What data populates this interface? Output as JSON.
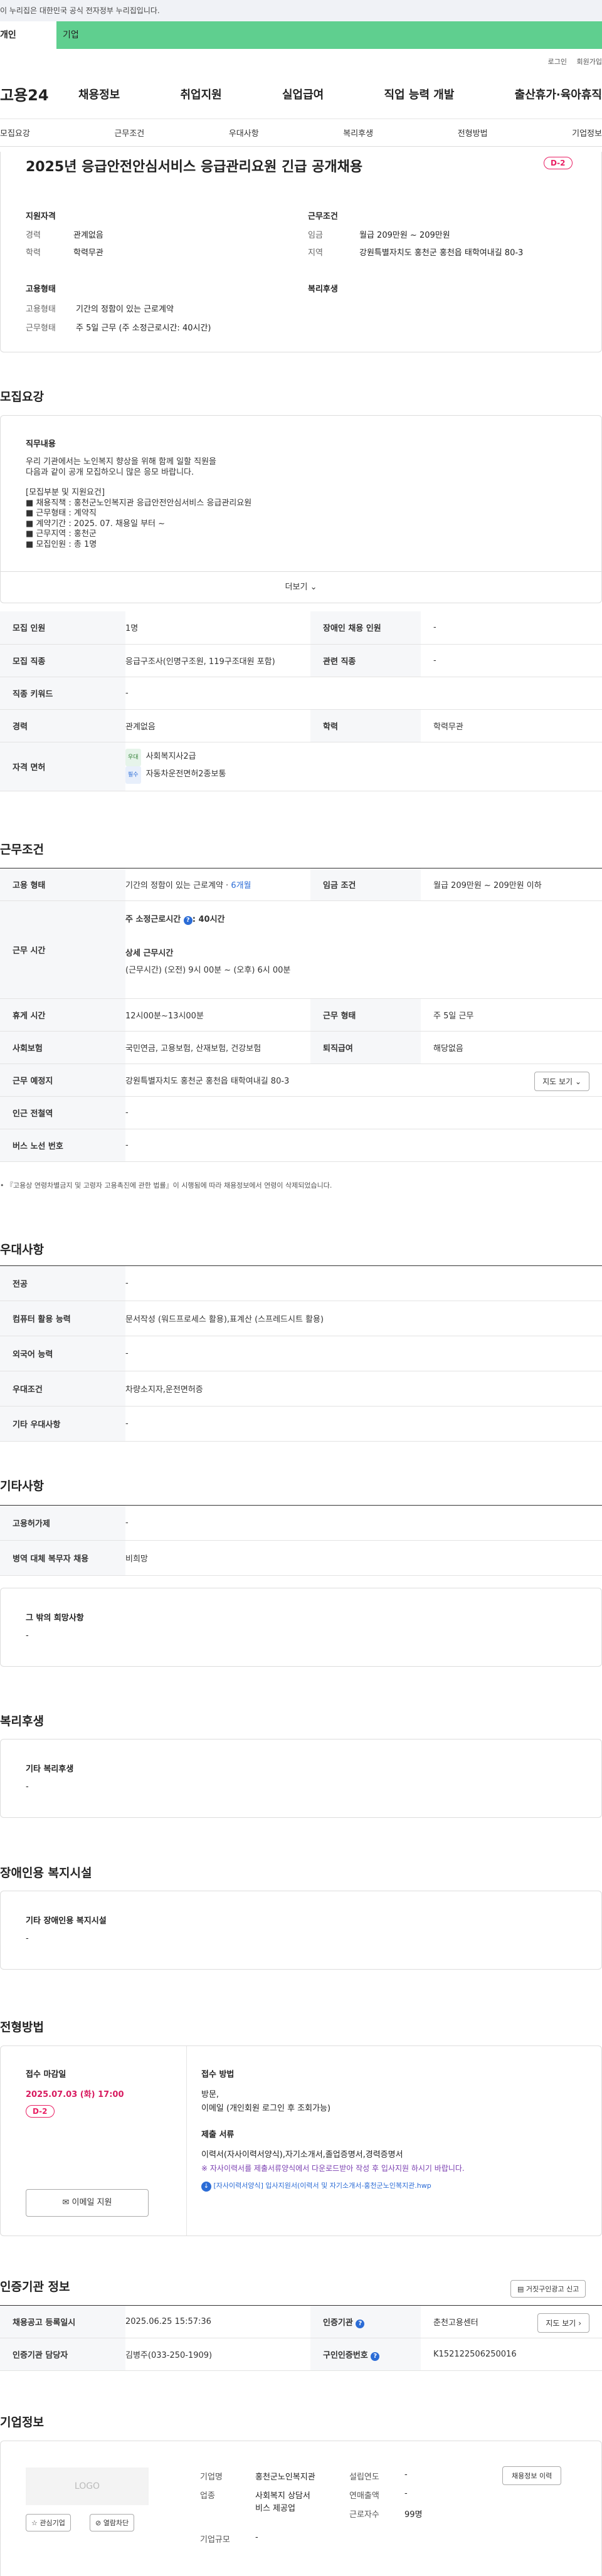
{
  "gov_banner": "이 누리집은 대한민국 공식 전자정부 누리집입니다.",
  "user_tabs": {
    "personal": "개인",
    "company": "기업"
  },
  "util": {
    "login": "로그인",
    "join": "회원가입"
  },
  "logo": "고용24",
  "gnb": [
    "채용정보",
    "취업지원",
    "실업급여",
    "직업 능력 개발",
    "출산휴가·육아휴직"
  ],
  "tabs": [
    "모집요강",
    "근무조건",
    "우대사항",
    "복리후생",
    "전형방법",
    "기업정보"
  ],
  "job": {
    "title": "2025년 응급안전안심서비스 응급관리요원 긴급 공개채용",
    "dday": "D-2",
    "qual_title": "지원자격",
    "career_k": "경력",
    "career_v": "관계없음",
    "edu_k": "학력",
    "edu_v": "학력무관",
    "cond_title": "근무조건",
    "wage_k": "임금",
    "wage_v": "월급 209만원 ~ 209만원",
    "region_k": "지역",
    "region_v": "강원특별자치도 홍천군 홍천읍 태학여내길 80-3",
    "emp_title": "고용형태",
    "emptype_k": "고용형태",
    "emptype_v": "기간의 정함이 있는 근로계약",
    "worktype_k": "근무형태",
    "worktype_v": "주 5일 근무 (주 소정근로시간: 40시간)",
    "welfare_title": "복리후생"
  },
  "recruit": {
    "section": "모집요강",
    "duty_title": "직무내용",
    "duty_lines": [
      "우리 기관에서는 노인복지 향상을 위해 함께 일할 직원을",
      "다음과 같이 공개 모집하오니 많은 응모 바랍니다.",
      "",
      "[모집부분 및 지원요건]",
      "■ 채용직책 : 홍천군노인복지관 응급안전안심서비스 응급관리요원",
      "■ 근무형태 : 계약직",
      "■ 계약기간 : 2025. 07. 채용일 부터 ~",
      "■ 근무지역 : 홍천군",
      "■ 모집인원 : 총 1명"
    ],
    "more": "더보기",
    "rows": {
      "count_k": "모집 인원",
      "count_v": "1명",
      "disabled_k": "장애인 채용 인원",
      "disabled_v": "-",
      "job_k": "모집 직종",
      "job_v": "응급구조사(인명구조원, 119구조대원 포함)",
      "related_k": "관련 직종",
      "related_v": "-",
      "keyword_k": "직종 키워드",
      "keyword_v": "-",
      "career_k": "경력",
      "career_v": "관계없음",
      "edu_k": "학력",
      "edu_v": "학력무관",
      "license_k": "자격 면허",
      "lic1_tag": "우대",
      "lic1": "사회복지사2급",
      "lic2_tag": "필수",
      "lic2": "자동차운전면허2종보통"
    }
  },
  "work": {
    "section": "근무조건",
    "emptype_k": "고용 형태",
    "emptype_v": "기간의 정함이 있는 근로계약 · ",
    "emptype_link": "6개월",
    "wage_k": "임금 조건",
    "wage_v": "월급 209만원 ~ 209만원 이하",
    "time_k": "근무 시간",
    "time_week": "주 소정근로시간",
    "time_week_v": ": 40시간",
    "time_detail_t": "상세 근무시간",
    "time_detail": "(근무시간) (오전) 9시 00분 ~ (오후) 6시 00분",
    "rest_k": "휴게 시간",
    "rest_v": "12시00분~13시00분",
    "form_k": "근무 형태",
    "form_v": "주 5일 근무",
    "ins_k": "사회보험",
    "ins_v": "국민연금, 고용보험, 산재보험, 건강보험",
    "retire_k": "퇴직급여",
    "retire_v": "해당없음",
    "place_k": "근무 예정지",
    "place_v": "강원특별자치도 홍천군 홍천읍 태학여내길 80-3",
    "map_btn": "지도 보기",
    "subway_k": "인근 전철역",
    "subway_v": "-",
    "bus_k": "버스 노선 번호",
    "bus_v": "-",
    "note": "『고용상 연령차별금지 및 고령자 고용촉진에 관한 법률』이 시행됨에 따라 채용정보에서 연령이 삭제되었습니다."
  },
  "pref": {
    "section": "우대사항",
    "major_k": "전공",
    "major_v": "-",
    "pc_k": "컴퓨터 활용 능력",
    "pc_v": "문서작성 (워드프로세스 활용),표계산 (스프레드시트 활용)",
    "lang_k": "외국어 능력",
    "lang_v": "-",
    "cond_k": "우대조건",
    "cond_v": "차량소지자,운전면허증",
    "etc_k": "기타 우대사항",
    "etc_v": "-"
  },
  "etc": {
    "section": "기타사항",
    "emp_k": "고용허가제",
    "emp_v": "-",
    "mil_k": "병역 대체 복무자 채용",
    "mil_v": "비희망",
    "other_t": "그 밖의 희망사항",
    "other_v": "-"
  },
  "welfare": {
    "section": "복리후생",
    "t": "기타 복리후생",
    "v": "-"
  },
  "disab": {
    "section": "장애인용 복지시설",
    "t": "기타 장애인용 복지시설",
    "v": "-"
  },
  "select": {
    "section": "전형방법",
    "deadline_t": "접수 마감일",
    "deadline_v": "2025.07.03 (화) 17:00",
    "dday": "D-2",
    "email_btn": "이메일 지원",
    "method_t": "접수 방법",
    "method_v1": "방문,",
    "method_v2": "이메일 (개인회원 로그인 후 조회가능)",
    "docs_t": "제출 서류",
    "docs_v": "이력서(자사이력서양식),자기소개서,졸업증명서,경력증명서",
    "docs_warn": "※ 자사이력서를 제출서류양식에서 다운로드받아 작성 후 입사지원 하시기 바랍니다.",
    "file": "[자사이력서양식] 입사지원서(이력서 및 자기소개서-홍천군노인복지관.hwp"
  },
  "agency": {
    "section": "인증기관 정보",
    "report_btn": "거짓구인광고 신고",
    "reg_k": "채용공고 등록일시",
    "reg_v": "2025.06.25 15:57:36",
    "org_k": "인증기관",
    "org_v": "춘천고용센터",
    "map_btn": "지도 보기",
    "mgr_k": "인증기관 담당자",
    "mgr_v": "김병주(033-250-1909)",
    "no_k": "구인인증번호",
    "no_v": "K152122506250016"
  },
  "company": {
    "section": "기업정보",
    "logo": "LOGO",
    "fav_btn": "관심기업",
    "block_btn": "열람차단",
    "name_k": "기업명",
    "name_v": "홍천군노인복지관",
    "ind_k": "업종",
    "ind_v1": "사회복지 상담서",
    "ind_v2": "비스 제공업",
    "size_k": "기업규모",
    "size_v": "-",
    "est_k": "설립연도",
    "est_v": "-",
    "sales_k": "연매출액",
    "sales_v": "-",
    "emp_k": "근로자수",
    "emp_v": "99명",
    "history_btn": "채용정보 이력"
  }
}
